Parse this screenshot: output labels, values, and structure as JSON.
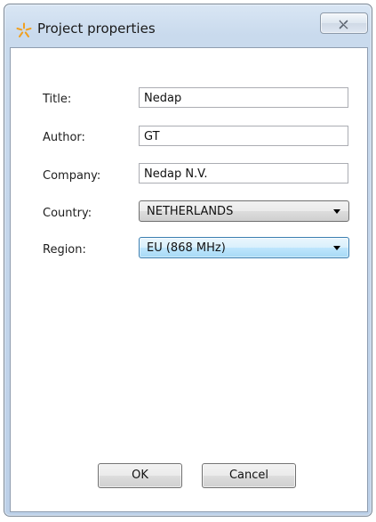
{
  "window": {
    "title": "Project properties",
    "icon": "star-icon",
    "close_icon": "close-icon"
  },
  "form": {
    "title_label": "Title:",
    "title_value": "Nedap",
    "author_label": "Author:",
    "author_value": "GT",
    "company_label": "Company:",
    "company_value": "Nedap N.V.",
    "country_label": "Country:",
    "country_value": "NETHERLANDS",
    "region_label": "Region:",
    "region_value": "EU (868 MHz)"
  },
  "buttons": {
    "ok_label": "OK",
    "cancel_label": "Cancel"
  },
  "colors": {
    "icon_orange": "#f0a020",
    "focus_blue": "#3c7fb1"
  }
}
